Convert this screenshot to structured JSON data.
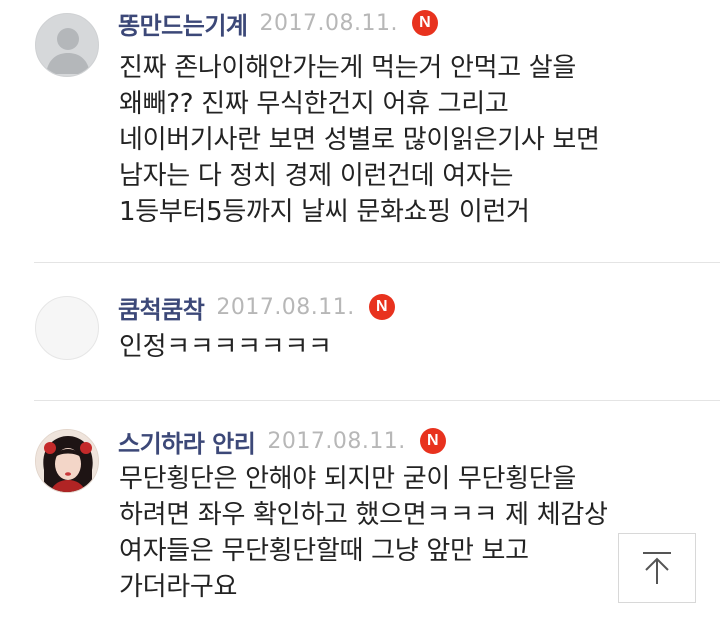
{
  "comments": [
    {
      "nickname": "똥만드는기계",
      "date": "2017.08.11.",
      "badge": "N",
      "avatar": "default-user-icon",
      "lines": [
        "진짜 존나이해안가는게 먹는거 안먹고 살을",
        "왜빼?? 진짜 무식한건지 어휴 그리고",
        "네이버기사란 보면 성별로 많이읽은기사 보면",
        "남자는 다 정치 경제 이런건데 여자는",
        "1등부터5등까지 날씨 문화쇼핑 이런거"
      ]
    },
    {
      "nickname": "쿰척쿰착",
      "date": "2017.08.11.",
      "badge": "N",
      "avatar": "blank-avatar",
      "lines": [
        "인정ㅋㅋㅋㅋㅋㅋㅋ"
      ]
    },
    {
      "nickname": "스기하라 안리",
      "date": "2017.08.11.",
      "badge": "N",
      "avatar": "profile-photo",
      "lines": [
        "무단횡단은 안해야 되지만 굳이 무단횡단을",
        "하려면 좌우 확인하고 했으면ㅋㅋㅋ 제 체감상",
        "여자들은 무단횡단할때 그냥 앞만 보고",
        "가더라구요"
      ]
    }
  ],
  "colors": {
    "nickname": "#3c4878",
    "date": "#b7b7b7",
    "badge": "#e8321e",
    "divider": "#e4e4e4"
  },
  "scroll_top_button": {
    "icon": "arrow-up-icon"
  }
}
